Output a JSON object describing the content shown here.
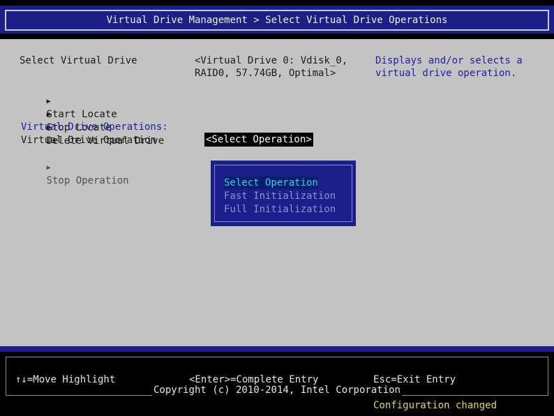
{
  "header": {
    "title": "Virtual Drive Management > Select Virtual Drive Operations"
  },
  "form": {
    "select_vd_label": "Select Virtual Drive",
    "select_vd_value_line1": "<Virtual Drive 0: Vdisk_0,",
    "select_vd_value_line2": "RAID0, 57.74GB, Optimal>",
    "actions": [
      {
        "marker": "▶",
        "label": "Start Locate"
      },
      {
        "marker": "▶",
        "label": "Stop Locate"
      },
      {
        "marker": "▶",
        "label": "Delete Virtual Drive"
      }
    ],
    "section_heading": "Virtual Drive Operations:",
    "vd_operation_label": "Virtual Drive Operation",
    "vd_operation_value": "<Select Operation>",
    "stop_operation": {
      "marker": "▶",
      "label": "Stop Operation"
    }
  },
  "help": {
    "line1": "Displays and/or selects a",
    "line2": "virtual drive operation."
  },
  "popup": {
    "options": [
      "Select Operation",
      "Fast Initialization",
      "Full Initialization"
    ],
    "selected": "Select Operation"
  },
  "status": {
    "hint_move": "↑↓=Move Highlight",
    "hint_enter": "<Enter>=Complete Entry",
    "hint_esc": "Esc=Exit Entry",
    "copyright": "Copyright (c) 2010-2014, Intel Corporation",
    "config_message": "Configuration changed"
  },
  "colors": {
    "title_bar": "#1c1f86",
    "body_background": "#c3c3c3",
    "highlight_text": "#23d4ea",
    "status_message": "#e4d84a"
  }
}
